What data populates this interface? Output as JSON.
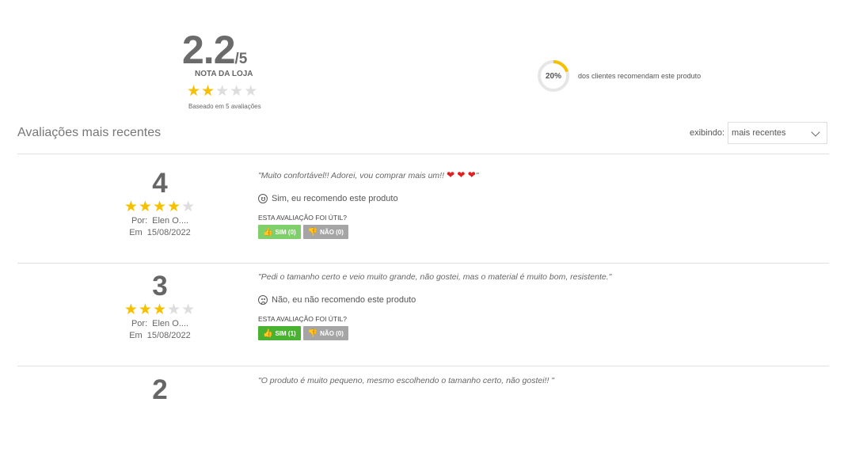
{
  "summary": {
    "score": "2.2",
    "outof": "/5",
    "label": "NOTA DA LOJA",
    "stars": 2,
    "based_on": "Baseado em 5 avaliações"
  },
  "recommend": {
    "percent_text": "20%",
    "percent_value": 0.2,
    "text": "dos clientes recomendam este produto"
  },
  "section_title": "Avaliações mais recentes",
  "sort": {
    "label": "exibindo:",
    "selected": "mais recentes"
  },
  "colors": {
    "star_on": "#f5c000",
    "star_off": "#dddddd",
    "ring_fill": "#f5c000",
    "ring_track": "#e6e6e6",
    "yes_light": "#7fcf6a",
    "yes_strong": "#49b230",
    "no": "#a5a5a5"
  },
  "reviews": [
    {
      "score": "4",
      "stars": 4,
      "by_label": "Por:",
      "author": "Elen O....",
      "date_label": "Em",
      "date": "15/08/2022",
      "comment": "\"Muito confortável!! Adorei, vou comprar mais um!! ",
      "comment_hearts": "❤ ❤ ❤",
      "comment_end": "\"",
      "recommends": true,
      "reco_text": "Sim, eu recomendo este produto",
      "useful_label": "ESTA AVALIAÇÃO FOI ÚTIL?",
      "yes_label": "SIM (0)",
      "no_label": "NÃO (0)"
    },
    {
      "score": "3",
      "stars": 3,
      "by_label": "Por:",
      "author": "Elen O....",
      "date_label": "Em",
      "date": "15/08/2022",
      "comment": "\"Pedi o tamanho certo e veio muito grande, não gostei, mas o material é muito bom, resistente.\"",
      "comment_hearts": "",
      "comment_end": "",
      "recommends": false,
      "reco_text": "Não, eu não recomendo este produto",
      "useful_label": "ESTA AVALIAÇÃO FOI ÚTIL?",
      "yes_label": "SIM (1)",
      "no_label": "NÃO (0)"
    },
    {
      "score": "2",
      "comment": "\"O produto é muito pequeno, mesmo escolhendo o tamanho certo, não gostei!! ",
      "comment_hearts": "",
      "comment_end": "\""
    }
  ]
}
